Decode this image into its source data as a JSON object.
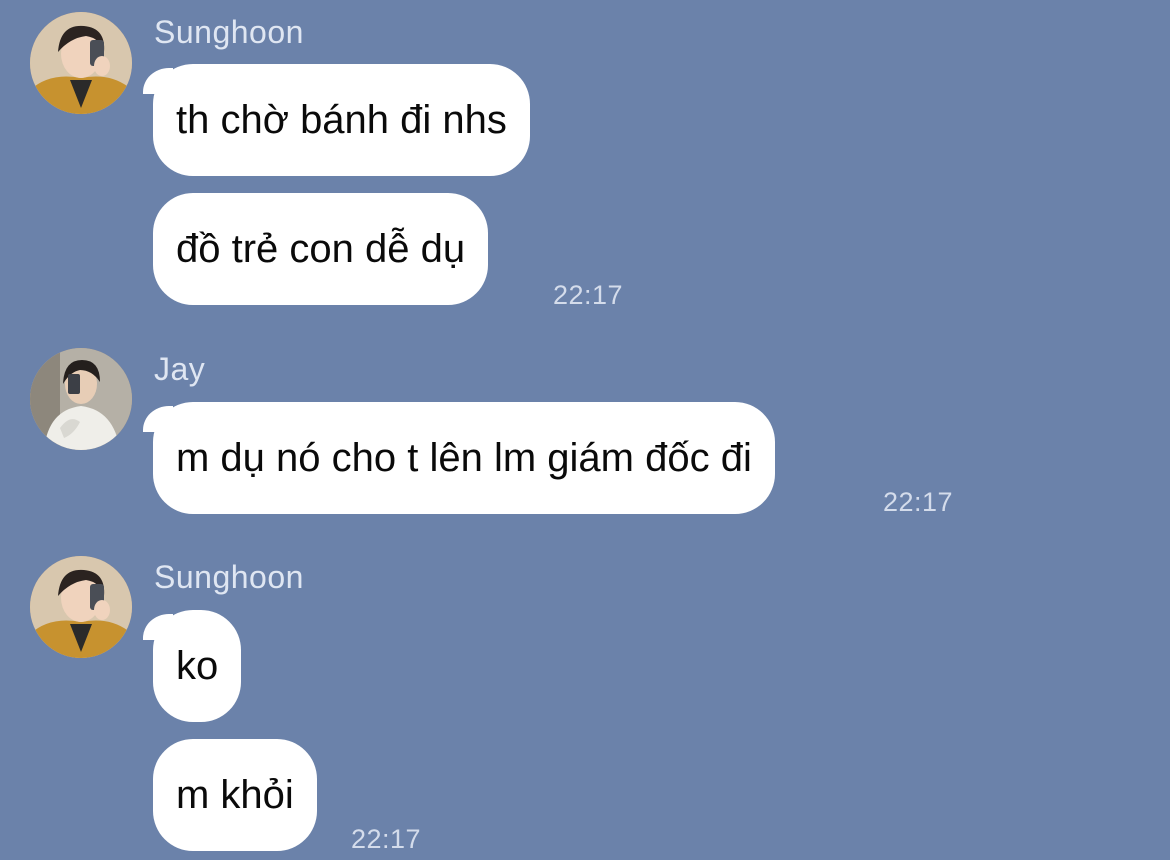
{
  "messages": [
    {
      "sender": "Sunghoon",
      "avatar_icon": "sunghoon-avatar",
      "bubbles": [
        "th chờ bánh đi nhs",
        "đồ trẻ con dễ dụ"
      ],
      "time": "22:17"
    },
    {
      "sender": "Jay",
      "avatar_icon": "jay-avatar",
      "bubbles": [
        "m dụ nó cho t lên lm giám đốc đi"
      ],
      "time": "22:17"
    },
    {
      "sender": "Sunghoon",
      "avatar_icon": "sunghoon-avatar",
      "bubbles": [
        "ko",
        "m khỏi"
      ],
      "time": "22:17"
    }
  ],
  "colors": {
    "background": "#6b82aa",
    "bubble": "#ffffff",
    "sender_name": "#dfe6f2",
    "timestamp": "#d4dceb"
  }
}
